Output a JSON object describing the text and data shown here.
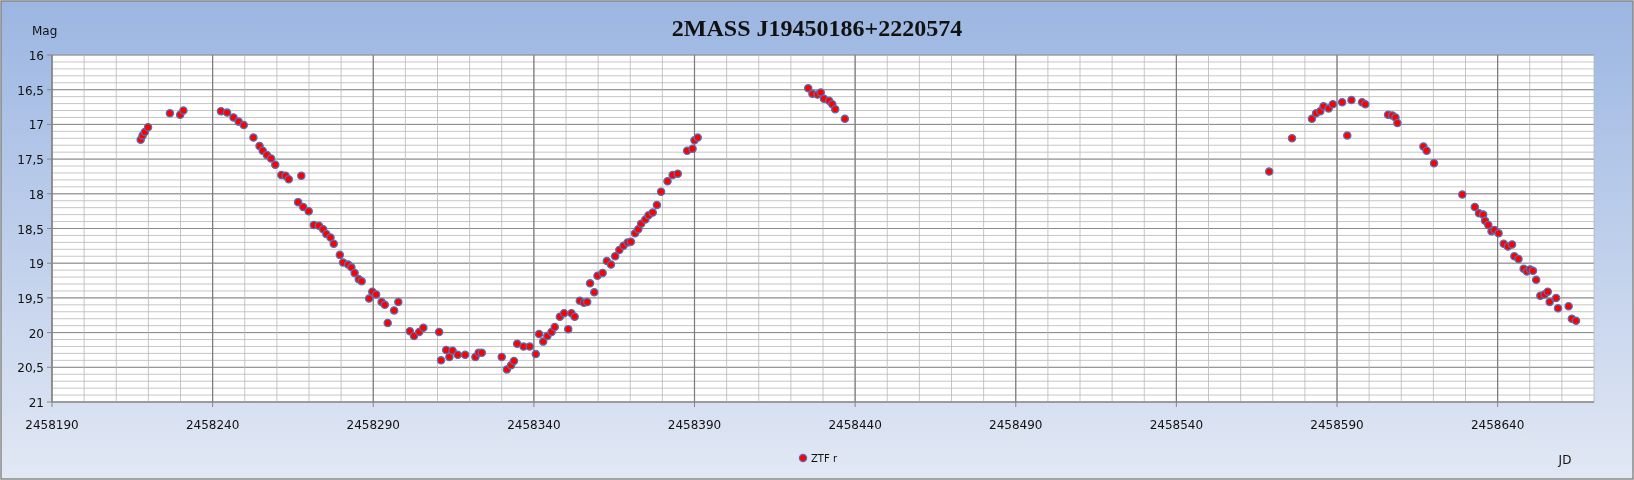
{
  "chart_data": {
    "type": "scatter",
    "title": "2MASS J19450186+2220574",
    "xlabel": "JD",
    "ylabel": "Mag",
    "x": [
      2458217.6,
      2458218.2,
      2458218.9,
      2458219.9,
      2458226.7,
      2458229.9,
      2458230.9,
      2458242.6,
      2458244.5,
      2458246.5,
      2458248.1,
      2458249.7,
      2458252.7,
      2458254.6,
      2458255.6,
      2458256.9,
      2458258.2,
      2458259.5,
      2458261.4,
      2458262.7,
      2458263.7,
      2458267.6,
      2458266.6,
      2458268.2,
      2458269.9,
      2458271.5,
      2458273.1,
      2458274.4,
      2458275.4,
      2458276.7,
      2458277.7,
      2458279.6,
      2458280.6,
      2458282.2,
      2458283.2,
      2458284.2,
      2458285.5,
      2458286.4,
      2458288.7,
      2458289.7,
      2458290.9,
      2458292.6,
      2458293.6,
      2458294.5,
      2458296.5,
      2458297.8,
      2458301.4,
      2458302.7,
      2458304.3,
      2458305.6,
      2458310.5,
      2458311.1,
      2458312.7,
      2458313.7,
      2458314.7,
      2458316.3,
      2458318.6,
      2458321.8,
      2458322.8,
      2458323.8,
      2458330.0,
      2458331.6,
      2458332.9,
      2458333.8,
      2458334.8,
      2458336.8,
      2458338.7,
      2458340.6,
      2458341.6,
      2458342.9,
      2458344.2,
      2458345.5,
      2458346.5,
      2458348.1,
      2458349.4,
      2458350.7,
      2458351.7,
      2458352.7,
      2458354.3,
      2458355.6,
      2458356.6,
      2458357.5,
      2458358.8,
      2458359.8,
      2458361.4,
      2458362.7,
      2458364.0,
      2458365.3,
      2458366.6,
      2458367.9,
      2458369.2,
      2458370.2,
      2458371.5,
      2458372.5,
      2458373.4,
      2458374.7,
      2458375.7,
      2458377.0,
      2458378.3,
      2458379.6,
      2458381.6,
      2458383.2,
      2458384.8,
      2458387.7,
      2458389.4,
      2458390.0,
      2458391.0,
      2458425.4,
      2458426.7,
      2458428.3,
      2458429.3,
      2458430.3,
      2458431.9,
      2458432.9,
      2458433.8,
      2458436.8,
      2458568.9,
      2458576.0,
      2458582.2,
      2458583.5,
      2458584.8,
      2458585.8,
      2458587.4,
      2458588.7,
      2458591.6,
      2458593.2,
      2458594.5,
      2458597.8,
      2458598.8,
      2458605.9,
      2458607.2,
      2458608.2,
      2458608.8,
      2458616.9,
      2458617.9,
      2458620.2,
      2458629.0,
      2458632.9,
      2458634.2,
      2458635.5,
      2458636.1,
      2458637.1,
      2458638.1,
      2458639.0,
      2458640.3,
      2458641.9,
      2458643.2,
      2458644.5,
      2458645.2,
      2458646.5,
      2458648.1,
      2458649.1,
      2458650.1,
      2458651.0,
      2458652.0,
      2458653.3,
      2458654.6,
      2458655.6,
      2458656.2,
      2458658.2,
      2458658.8,
      2458662.1,
      2458663.1,
      2458664.4
    ],
    "series": [
      {
        "name": "ZTF r",
        "color": "#ff0000",
        "values": [
          17.22,
          17.16,
          17.11,
          17.04,
          16.84,
          16.86,
          16.8,
          16.81,
          16.83,
          16.9,
          16.96,
          17.01,
          17.19,
          17.31,
          17.38,
          17.44,
          17.49,
          17.58,
          17.73,
          17.74,
          17.79,
          17.74,
          18.12,
          18.19,
          18.25,
          18.45,
          18.46,
          18.51,
          18.58,
          18.63,
          18.72,
          18.88,
          18.99,
          19.02,
          19.06,
          19.14,
          19.23,
          19.26,
          19.51,
          19.41,
          19.45,
          19.56,
          19.6,
          19.86,
          19.68,
          19.56,
          19.98,
          20.05,
          19.99,
          19.93,
          19.99,
          20.4,
          20.25,
          20.35,
          20.26,
          20.32,
          20.32,
          20.35,
          20.29,
          20.29,
          20.35,
          20.53,
          20.47,
          20.41,
          20.16,
          20.2,
          20.2,
          20.31,
          20.02,
          20.13,
          20.05,
          19.99,
          19.92,
          19.77,
          19.72,
          19.95,
          19.72,
          19.77,
          19.54,
          19.57,
          19.56,
          19.29,
          19.42,
          19.18,
          19.14,
          18.97,
          19.02,
          18.9,
          18.81,
          18.75,
          18.7,
          18.69,
          18.57,
          18.51,
          18.43,
          18.37,
          18.31,
          18.27,
          18.16,
          17.97,
          17.82,
          17.73,
          17.71,
          17.38,
          17.35,
          17.23,
          17.19,
          16.48,
          16.56,
          16.57,
          16.54,
          16.63,
          16.66,
          16.71,
          16.78,
          16.92,
          17.68,
          17.2,
          16.92,
          16.84,
          16.81,
          16.74,
          16.77,
          16.71,
          16.68,
          17.16,
          16.65,
          16.68,
          16.71,
          16.86,
          16.87,
          16.9,
          16.98,
          17.32,
          17.38,
          17.56,
          18.01,
          18.19,
          18.28,
          18.3,
          18.39,
          18.45,
          18.54,
          18.52,
          18.57,
          18.72,
          18.76,
          18.73,
          18.9,
          18.94,
          19.08,
          19.12,
          19.09,
          19.11,
          19.24,
          19.47,
          19.45,
          19.41,
          19.56,
          19.5,
          19.65,
          19.62,
          19.8,
          19.83
        ]
      }
    ],
    "grid": true,
    "xlim": [
      2458190,
      2458670
    ],
    "ylim": [
      21,
      16
    ],
    "xticks": [
      2458190,
      2458240,
      2458290,
      2458340,
      2458390,
      2458440,
      2458490,
      2458540,
      2458590,
      2458640
    ],
    "yticks": [
      16,
      {
        "value": 16.5,
        "label": "16,5"
      },
      17,
      {
        "value": 17.5,
        "label": "17,5"
      },
      18,
      {
        "value": 18.5,
        "label": "18,5"
      },
      19,
      {
        "value": 19.5,
        "label": "19,5"
      },
      20,
      {
        "value": 20.5,
        "label": "20,5"
      },
      21
    ]
  }
}
